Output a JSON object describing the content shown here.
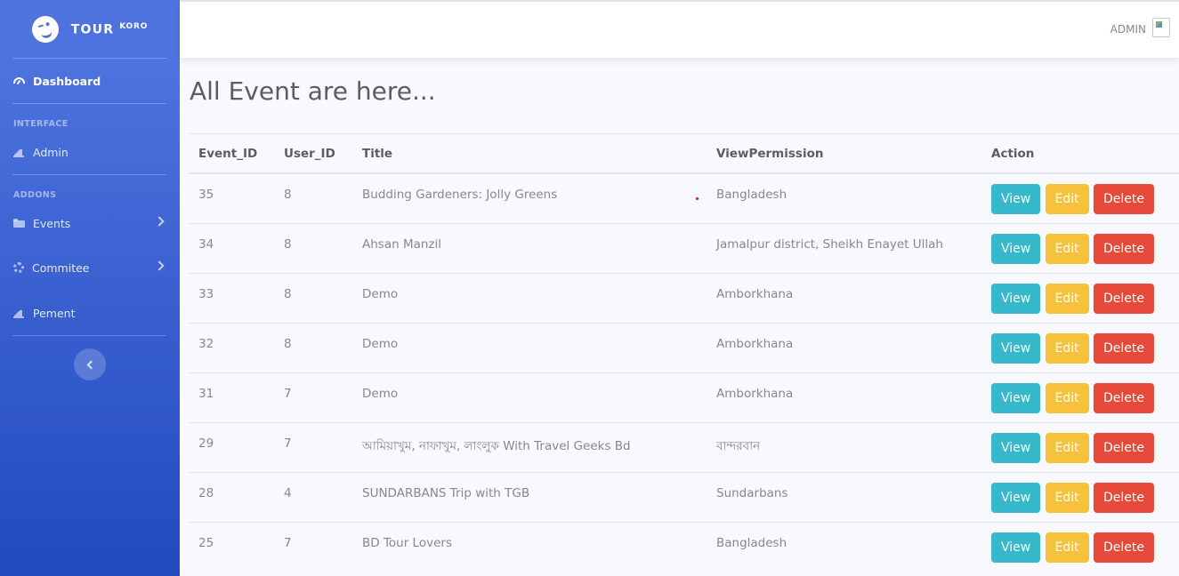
{
  "brand": {
    "name": "TOUR",
    "sup": "KORO"
  },
  "sidebar": {
    "dashboard": "Dashboard",
    "heading_interface": "INTERFACE",
    "admin": "Admin",
    "heading_addons": "ADDONS",
    "events": "Events",
    "commitee": "Commitee",
    "pement": "Pement"
  },
  "topbar": {
    "user": "ADMIN"
  },
  "page": {
    "title": "All Event are here..."
  },
  "table": {
    "headers": [
      "Event_ID",
      "User_ID",
      "Title",
      "ViewPermission",
      "Action"
    ],
    "actions": {
      "view": "View",
      "edit": "Edit",
      "delete": "Delete"
    },
    "rows": [
      {
        "event_id": "35",
        "user_id": "8",
        "title": "Budding Gardeners: Jolly Greens",
        "view_permission": "Bangladesh"
      },
      {
        "event_id": "34",
        "user_id": "8",
        "title": "Ahsan Manzil",
        "view_permission": "Jamalpur district, Sheikh Enayet Ullah"
      },
      {
        "event_id": "33",
        "user_id": "8",
        "title": "Demo",
        "view_permission": "Amborkhana"
      },
      {
        "event_id": "32",
        "user_id": "8",
        "title": "Demo",
        "view_permission": "Amborkhana"
      },
      {
        "event_id": "31",
        "user_id": "7",
        "title": "Demo",
        "view_permission": "Amborkhana"
      },
      {
        "event_id": "29",
        "user_id": "7",
        "title": "আমিয়াখুম, নাফাখুম, লাংলুক With Travel Geeks Bd",
        "view_permission": "বান্দরবান"
      },
      {
        "event_id": "28",
        "user_id": "4",
        "title": "SUNDARBANS Trip with TGB",
        "view_permission": "Sundarbans"
      },
      {
        "event_id": "25",
        "user_id": "7",
        "title": "BD Tour Lovers",
        "view_permission": "Bangladesh"
      }
    ]
  },
  "colors": {
    "primary": "#4e73df",
    "info": "#36b9cc",
    "warning": "#f6c23e",
    "danger": "#e74a3b"
  }
}
